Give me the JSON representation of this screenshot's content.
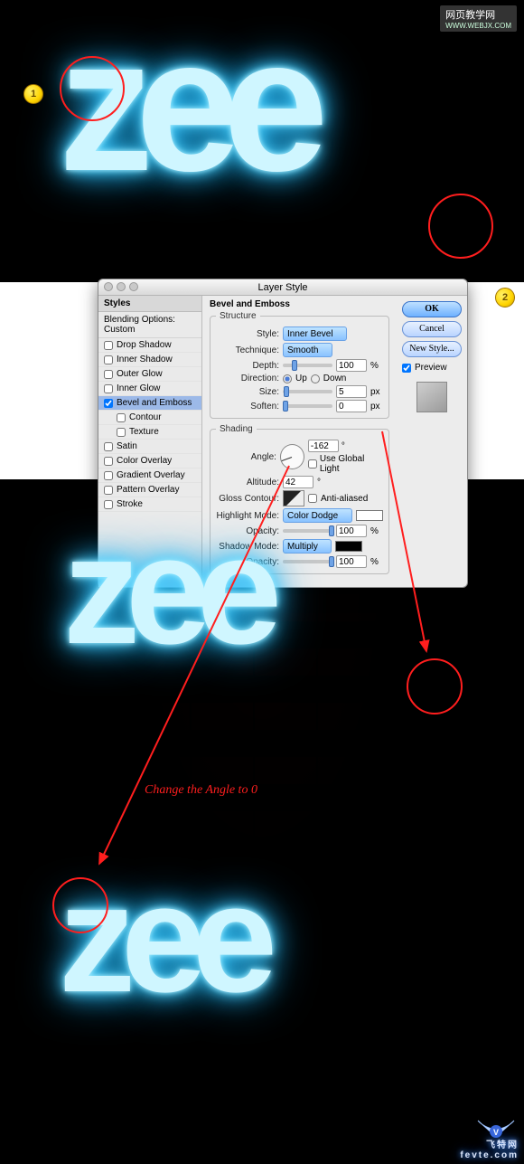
{
  "top_watermark": {
    "line1": "网页教学网",
    "line2": "WWW.WEBJX.COM"
  },
  "markers": {
    "m1": "1",
    "m2": "2"
  },
  "neon_text": "zee",
  "caption": "Change the Angle to 0",
  "bottom_watermark": {
    "brand": "飞特网",
    "url": "fevte.com"
  },
  "dialog": {
    "title": "Layer Style",
    "side_header": "Styles",
    "blending_options": "Blending Options: Custom",
    "effects": {
      "drop_shadow": "Drop Shadow",
      "inner_shadow": "Inner Shadow",
      "outer_glow": "Outer Glow",
      "inner_glow": "Inner Glow",
      "bevel_emboss": "Bevel and Emboss",
      "contour": "Contour",
      "texture": "Texture",
      "satin": "Satin",
      "color_overlay": "Color Overlay",
      "gradient_overlay": "Gradient Overlay",
      "pattern_overlay": "Pattern Overlay",
      "stroke": "Stroke"
    },
    "panel_title": "Bevel and Emboss",
    "structure": {
      "legend": "Structure",
      "style_label": "Style:",
      "style_value": "Inner Bevel",
      "technique_label": "Technique:",
      "technique_value": "Smooth",
      "depth_label": "Depth:",
      "depth_value": "100",
      "depth_unit": "%",
      "direction_label": "Direction:",
      "up": "Up",
      "down": "Down",
      "size_label": "Size:",
      "size_value": "5",
      "size_unit": "px",
      "soften_label": "Soften:",
      "soften_value": "0",
      "soften_unit": "px"
    },
    "shading": {
      "legend": "Shading",
      "angle_label": "Angle:",
      "angle_value": "-162",
      "angle_unit": "°",
      "global_light": "Use Global Light",
      "altitude_label": "Altitude:",
      "altitude_value": "42",
      "altitude_unit": "°",
      "gloss_contour_label": "Gloss Contour:",
      "antialiased": "Anti-aliased",
      "highlight_mode_label": "Highlight Mode:",
      "highlight_mode_value": "Color Dodge",
      "highlight_opacity_label": "Opacity:",
      "highlight_opacity_value": "100",
      "opacity_unit": "%",
      "shadow_mode_label": "Shadow Mode:",
      "shadow_mode_value": "Multiply",
      "shadow_opacity_label": "Opacity:",
      "shadow_opacity_value": "100"
    },
    "buttons": {
      "ok": "OK",
      "cancel": "Cancel",
      "new_style": "New Style...",
      "preview": "Preview"
    }
  }
}
